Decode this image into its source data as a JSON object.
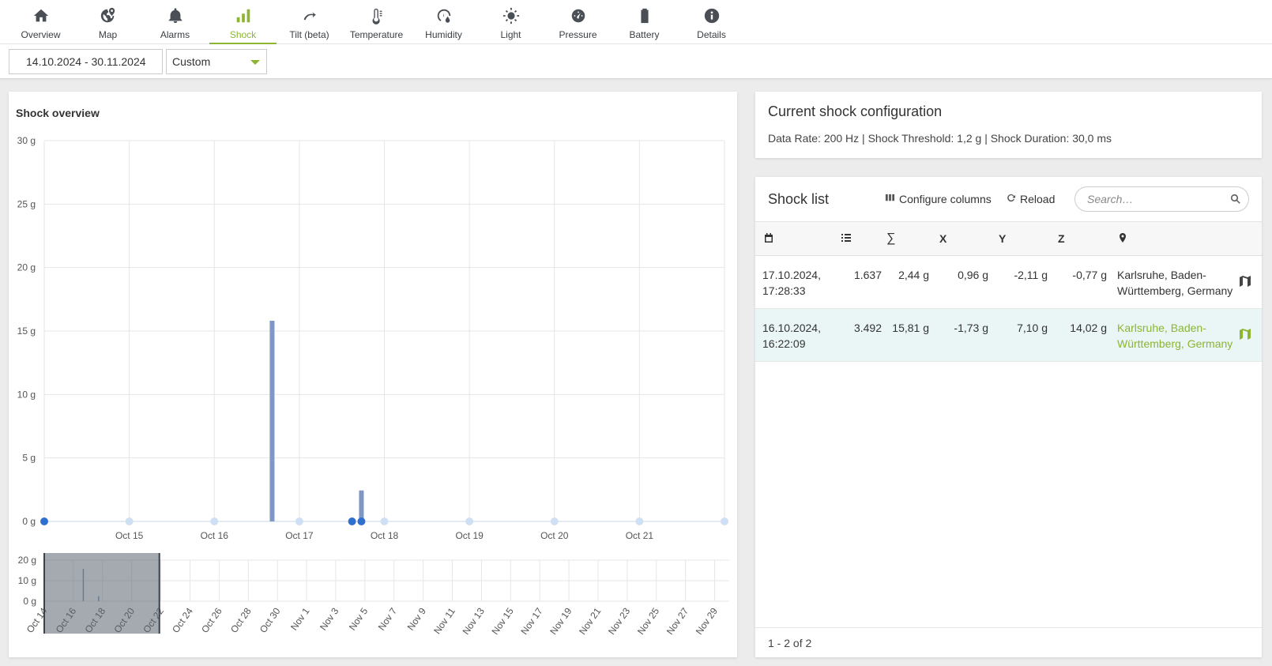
{
  "nav": {
    "items": [
      {
        "label": "Overview",
        "icon": "home-icon"
      },
      {
        "label": "Map",
        "icon": "globe-icon"
      },
      {
        "label": "Alarms",
        "icon": "bell-icon"
      },
      {
        "label": "Shock",
        "icon": "bar-chart-icon",
        "active": true
      },
      {
        "label": "Tilt (beta)",
        "icon": "tilt-arrow-icon"
      },
      {
        "label": "Temperature",
        "icon": "thermometer-icon"
      },
      {
        "label": "Humidity",
        "icon": "humidity-gauge-icon"
      },
      {
        "label": "Light",
        "icon": "sun-icon"
      },
      {
        "label": "Pressure",
        "icon": "pressure-gauge-icon"
      },
      {
        "label": "Battery",
        "icon": "battery-icon"
      },
      {
        "label": "Details",
        "icon": "info-icon"
      }
    ]
  },
  "filter": {
    "date_range": "14.10.2024 - 30.11.2024",
    "period": "Custom"
  },
  "overview": {
    "title": "Shock overview"
  },
  "chart_data": {
    "type": "bar",
    "title": "Shock overview",
    "y_ticks": [
      "30 g",
      "25 g",
      "20 g",
      "15 g",
      "10 g",
      "5 g",
      "0 g"
    ],
    "ylim": [
      0,
      30
    ],
    "unit": "g",
    "x_ticks": [
      "Oct 15",
      "Oct 16",
      "Oct 17",
      "Oct 18",
      "Oct 19",
      "Oct 20",
      "Oct 21"
    ],
    "x_range_days": [
      14.0,
      22.0
    ],
    "bars": [
      {
        "day": 16.68,
        "value": 15.81
      },
      {
        "day": 17.73,
        "value": 2.44
      }
    ],
    "markers": [
      {
        "day": 14.0,
        "style": "event"
      },
      {
        "day": 15.0,
        "style": "empty"
      },
      {
        "day": 16.0,
        "style": "empty"
      },
      {
        "day": 17.0,
        "style": "empty"
      },
      {
        "day": 17.62,
        "style": "event"
      },
      {
        "day": 17.73,
        "style": "event"
      },
      {
        "day": 18.0,
        "style": "empty"
      },
      {
        "day": 19.0,
        "style": "empty"
      },
      {
        "day": 20.0,
        "style": "empty"
      },
      {
        "day": 21.0,
        "style": "empty"
      },
      {
        "day": 22.0,
        "style": "empty"
      }
    ],
    "navigator": {
      "y_ticks": [
        "20 g",
        "10 g",
        "0 g"
      ],
      "x_ticks": [
        "Oct 14",
        "Oct 16",
        "Oct 18",
        "Oct 20",
        "Oct 22",
        "Oct 24",
        "Oct 26",
        "Oct 28",
        "Oct 30",
        "Nov 1",
        "Nov 3",
        "Nov 5",
        "Nov 7",
        "Nov 9",
        "Nov 11",
        "Nov 13",
        "Nov 15",
        "Nov 17",
        "Nov 19",
        "Nov 21",
        "Nov 23",
        "Nov 25",
        "Nov 27",
        "Nov 29"
      ],
      "selection_days": [
        14.0,
        21.9
      ]
    },
    "colors": {
      "bar": "#7e97c3",
      "event": "#2f6fd0",
      "empty": "#cfe0f5"
    }
  },
  "config": {
    "title": "Current shock configuration",
    "text": "Data Rate: 200 Hz | Shock Threshold: 1,2 g | Shock Duration: 30,0 ms"
  },
  "list": {
    "title": "Shock list",
    "configure_label": "Configure columns",
    "reload_label": "Reload",
    "search_placeholder": "Search…",
    "columns": [
      "date-col-icon",
      "count-col-icon",
      "∑",
      "X",
      "Y",
      "Z",
      "location-col-icon"
    ],
    "rows": [
      {
        "date": "17.10.2024,",
        "time": "17:28:33",
        "count": "1.637",
        "sum": "2,44 g",
        "x": "0,96 g",
        "y": "-2,11 g",
        "z": "-0,77 g",
        "loc1": "Karlsruhe, Baden-",
        "loc2": "Württemberg, Germany",
        "selected": false
      },
      {
        "date": "16.10.2024,",
        "time": "16:22:09",
        "count": "3.492",
        "sum": "15,81 g",
        "x": "-1,73 g",
        "y": "7,10 g",
        "z": "14,02 g",
        "loc1": "Karlsruhe, Baden-",
        "loc2": "Württemberg, Germany",
        "selected": true
      }
    ],
    "footer": "1 - 2 of 2"
  },
  "colors": {
    "accent": "#8db532",
    "selected_row": "#e9f6f5"
  }
}
